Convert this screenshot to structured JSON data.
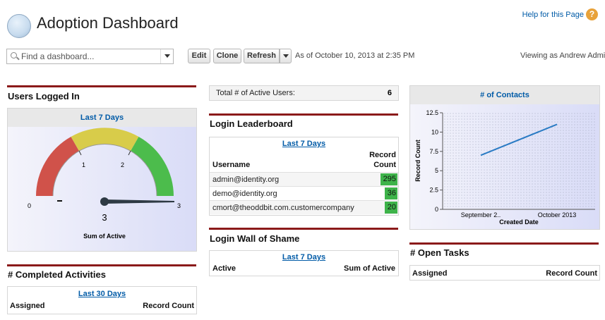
{
  "header": {
    "title": "Adoption Dashboard",
    "help_link": "Help for this Page"
  },
  "toolbar": {
    "search_placeholder": "Find a dashboard...",
    "edit": "Edit",
    "clone": "Clone",
    "refresh": "Refresh",
    "as_of": "As of October 10, 2013 at 2:35 PM",
    "viewing_as": "Viewing as Andrew Admin"
  },
  "users_logged_in": {
    "title": "Users Logged In",
    "period": "Last 7 Days",
    "gauge": {
      "min_label": "0",
      "max_label": "3",
      "tick_1": "1",
      "tick_2": "2",
      "value": 3,
      "value_label": "3",
      "caption": "Sum of Active",
      "colors": {
        "low": "#d0524a",
        "mid": "#d8cc4a",
        "high": "#4cbc4c"
      }
    }
  },
  "completed_activities": {
    "title": "# Completed Activities",
    "period": "Last 30 Days",
    "col_assigned": "Assigned",
    "col_count": "Record Count"
  },
  "total_active": {
    "label": "Total # of Active Users:",
    "value": "6"
  },
  "login_leaderboard": {
    "title": "Login Leaderboard",
    "period": "Last 7 Days",
    "col_username": "Username",
    "col_count_1": "Record",
    "col_count_2": "Count",
    "rows": [
      {
        "user": "admin@identity.org",
        "count": "295",
        "fill": 0.85
      },
      {
        "user": "demo@identity.org",
        "count": "36",
        "fill": 0.5
      },
      {
        "user": "cmort@theoddbit.com.customercompany",
        "count": "20",
        "fill": 0.5
      }
    ],
    "bar_color": "#3eb34a"
  },
  "wall_of_shame": {
    "title": "Login Wall of Shame",
    "period": "Last 7 Days",
    "col_active": "Active",
    "col_sum": "Sum of Active"
  },
  "contacts_chart": {
    "title": "# of Contacts",
    "ylabel": "Record Count",
    "xlabel": "Created Date",
    "yticks": [
      "0",
      "2.5",
      "5",
      "7.5",
      "10",
      "12.5"
    ],
    "xticks": [
      "September 2..",
      "October 2013"
    ]
  },
  "open_tasks": {
    "title": "# Open Tasks",
    "col_assigned": "Assigned",
    "col_count": "Record Count"
  },
  "chart_data": {
    "type": "line",
    "title": "# of Contacts",
    "xlabel": "Created Date",
    "ylabel": "Record Count",
    "categories": [
      "September 2..",
      "October 2013"
    ],
    "values": [
      7,
      11
    ],
    "ylim": [
      0,
      12.5
    ],
    "grid": true,
    "color": "#2a7bc4"
  }
}
